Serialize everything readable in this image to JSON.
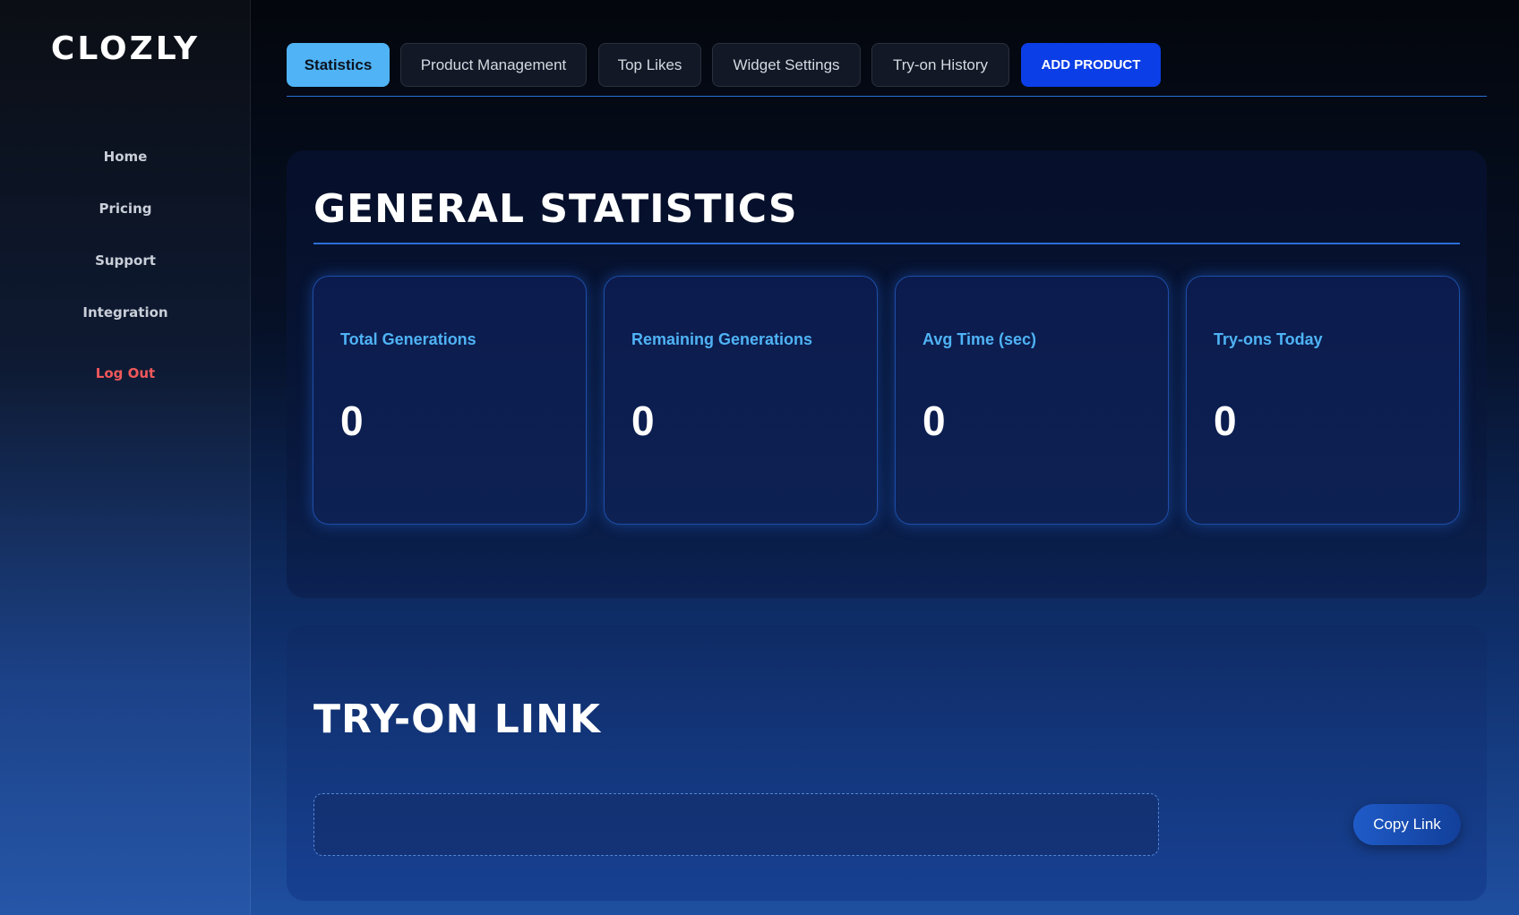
{
  "sidebar": {
    "logo": "CLOZLY",
    "items": [
      {
        "label": "Home"
      },
      {
        "label": "Pricing"
      },
      {
        "label": "Support"
      },
      {
        "label": "Integration"
      }
    ],
    "logout": "Log Out"
  },
  "tabs": [
    {
      "label": "Statistics",
      "active": true
    },
    {
      "label": "Product Management"
    },
    {
      "label": "Top Likes"
    },
    {
      "label": "Widget Settings"
    },
    {
      "label": "Try-on History"
    }
  ],
  "add_product": "ADD PRODUCT",
  "stats_section": {
    "title": "GENERAL STATISTICS",
    "cards": [
      {
        "label": "Total Generations",
        "value": "0"
      },
      {
        "label": "Remaining Generations",
        "value": "0"
      },
      {
        "label": "Avg Time (sec)",
        "value": "0"
      },
      {
        "label": "Try-ons Today",
        "value": "0"
      }
    ]
  },
  "link_section": {
    "title": "TRY-ON LINK",
    "link_value": "",
    "copy_label": "Copy Link"
  },
  "colors": {
    "accent": "#4fb3f5",
    "primary": "#0b3ee6",
    "logout": "#f0585b"
  }
}
